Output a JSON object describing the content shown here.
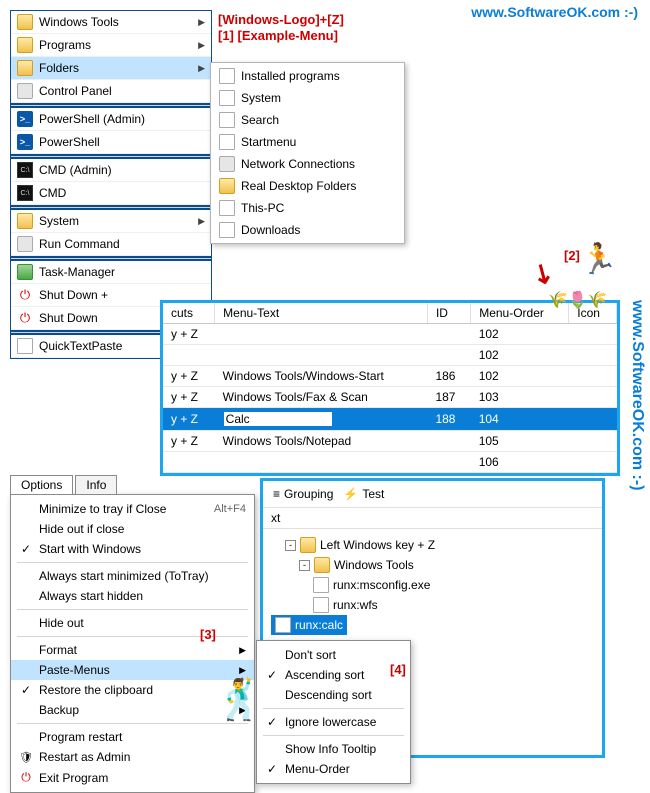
{
  "watermark_top": "www.SoftwareOK.com :-)",
  "watermark_side": "www.SoftwareOK.com :-)",
  "annotations": {
    "hotkey": "[Windows-Logo]+[Z]",
    "a1": "[1] [Example-Menu]",
    "a2": "[2]",
    "a3": "[3]",
    "a4": "[4]"
  },
  "main_menu": {
    "items": [
      {
        "label": "Windows Tools",
        "icon": "folder",
        "sub": true
      },
      {
        "label": "Programs",
        "icon": "folder",
        "sub": true
      },
      {
        "label": "Folders",
        "icon": "folder",
        "sub": true,
        "selected": true
      },
      {
        "label": "Control Panel",
        "icon": "sys"
      },
      {
        "label": "PowerShell (Admin)",
        "icon": "ps",
        "glyph": ">_"
      },
      {
        "label": "PowerShell",
        "icon": "ps",
        "glyph": ">_"
      },
      {
        "label": "CMD (Admin)",
        "icon": "cmd",
        "glyph": "C:\\"
      },
      {
        "label": "CMD",
        "icon": "cmd",
        "glyph": "C:\\"
      },
      {
        "label": "System",
        "icon": "folder",
        "sub": true
      },
      {
        "label": "Run Command",
        "icon": "sys"
      },
      {
        "label": "Task-Manager",
        "icon": "task"
      },
      {
        "label": "Shut Down +",
        "icon": "power",
        "glyph": "⏻"
      },
      {
        "label": "Shut Down",
        "icon": "power",
        "glyph": "⏻"
      },
      {
        "label": "QuickTextPaste",
        "icon": "page"
      }
    ],
    "separators_after": [
      3,
      5,
      7,
      9,
      12
    ]
  },
  "folders_submenu": [
    {
      "label": "Installed programs",
      "icon": "page"
    },
    {
      "label": "System",
      "icon": "page"
    },
    {
      "label": "Search",
      "icon": "page"
    },
    {
      "label": "Startmenu",
      "icon": "page"
    },
    {
      "label": "Network Connections",
      "icon": "sys"
    },
    {
      "label": "Real Desktop Folders",
      "icon": "folder"
    },
    {
      "label": "This-PC",
      "icon": "page"
    },
    {
      "label": "Downloads",
      "icon": "page"
    }
  ],
  "table": {
    "headers": [
      "cuts",
      "Menu-Text",
      "ID",
      "Menu-Order",
      "Icon"
    ],
    "rows": [
      {
        "cut": "y + Z",
        "text": "",
        "id": "",
        "order": "102",
        "icon": ""
      },
      {
        "cut": "",
        "text": "",
        "id": "",
        "order": "102",
        "icon": ""
      },
      {
        "cut": "y + Z",
        "text": "Windows Tools/Windows-Start",
        "id": "186",
        "order": "102",
        "icon": ""
      },
      {
        "cut": "y + Z",
        "text": "Windows Tools/Fax & Scan",
        "id": "187",
        "order": "103",
        "icon": ""
      },
      {
        "cut": "y + Z",
        "text": "Calc",
        "id": "188",
        "order": "104",
        "icon": "",
        "selected": true,
        "editing": true
      },
      {
        "cut": "y + Z",
        "text": "Windows Tools/Notepad",
        "id": "",
        "order": "105",
        "icon": ""
      },
      {
        "cut": "",
        "text": "",
        "id": "",
        "order": "106",
        "icon": ""
      }
    ]
  },
  "options": {
    "tabs": [
      "Options",
      "Info"
    ],
    "items": [
      {
        "label": "Minimize to tray if Close",
        "shortcut": "Alt+F4"
      },
      {
        "label": "Hide out if close"
      },
      {
        "label": "Start with Windows",
        "checked": true
      },
      {
        "sep": true
      },
      {
        "label": "Always start minimized (ToTray)"
      },
      {
        "label": "Always start hidden"
      },
      {
        "sep": true
      },
      {
        "label": "Hide out"
      },
      {
        "sep": true
      },
      {
        "label": "Format",
        "sub": true
      },
      {
        "label": "Paste-Menus",
        "sub": true,
        "selected": true
      },
      {
        "label": "Restore the clipboard",
        "checked": true
      },
      {
        "label": "Backup",
        "sub": true
      },
      {
        "sep": true
      },
      {
        "label": "Program restart"
      },
      {
        "label": "Restart as Admin",
        "icon": "shield"
      },
      {
        "label": "Exit Program",
        "icon": "exit"
      }
    ]
  },
  "sort_menu": [
    {
      "label": "Don't sort"
    },
    {
      "label": "Ascending sort",
      "checked": true
    },
    {
      "label": "Descending sort"
    },
    {
      "sep": true
    },
    {
      "label": "Ignore lowercase",
      "checked": true
    },
    {
      "sep": true
    },
    {
      "label": "Show Info Tooltip"
    },
    {
      "label": "Menu-Order",
      "checked": true
    }
  ],
  "back_panel": {
    "toolbar": {
      "grouping": "Grouping",
      "test": "Test"
    },
    "col_header": "xt",
    "tree": [
      {
        "label": "Left Windows key + Z",
        "icon": "folder",
        "depth": 1,
        "toggle": "-"
      },
      {
        "label": "Windows Tools",
        "icon": "folder",
        "depth": 2,
        "toggle": "-"
      },
      {
        "label": "runx:msconfig.exe",
        "icon": "page",
        "depth": 3
      },
      {
        "label": "runx:wfs",
        "icon": "page",
        "depth": 3
      },
      {
        "label": "runx:calc",
        "icon": "page",
        "depth": 3,
        "selected": true
      }
    ]
  }
}
